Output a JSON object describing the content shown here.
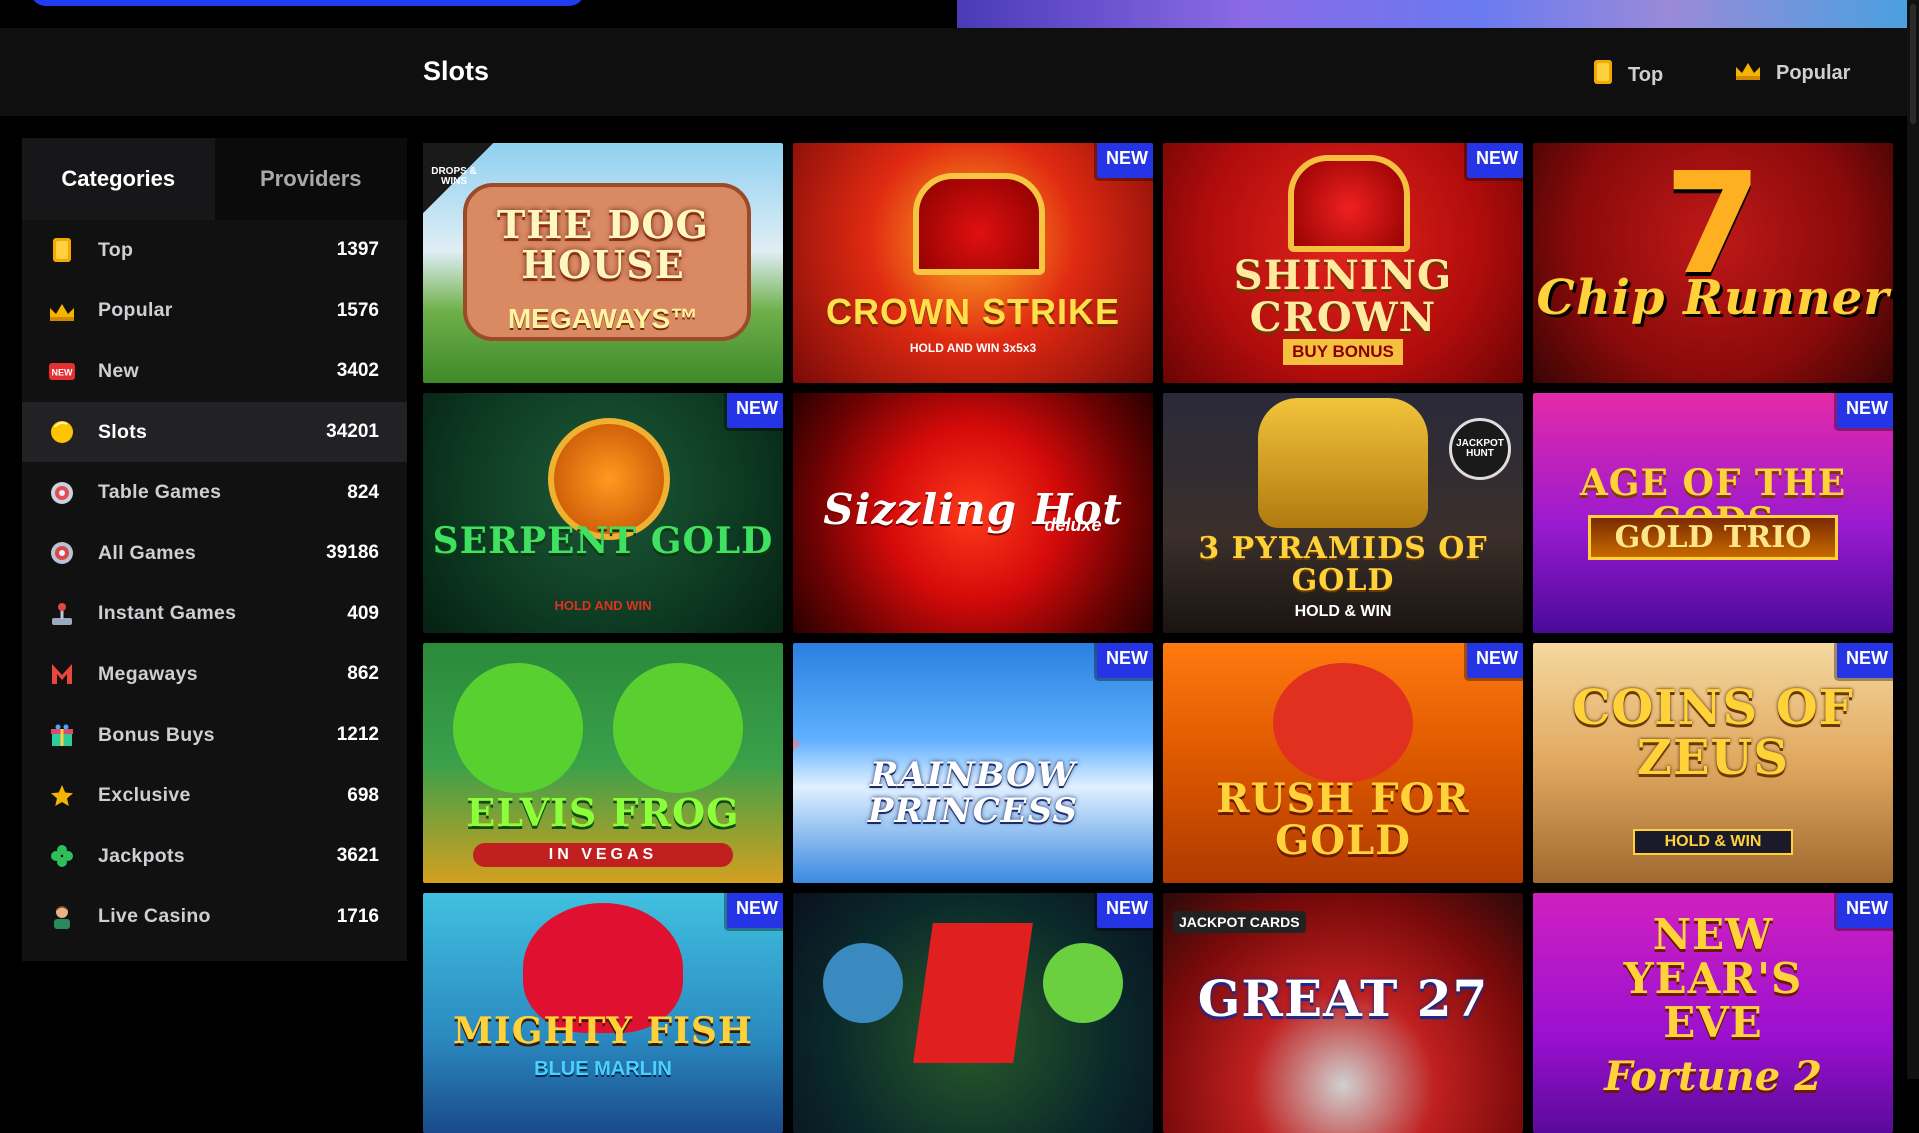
{
  "header": {
    "title": "Slots",
    "links": [
      {
        "label": "Top",
        "icon": "top-icon"
      },
      {
        "label": "Popular",
        "icon": "crown-icon"
      }
    ]
  },
  "sidebar": {
    "tabs": [
      "Categories",
      "Providers"
    ],
    "items": [
      {
        "label": "Top",
        "count": "1397",
        "icon": "top-icon"
      },
      {
        "label": "Popular",
        "count": "1576",
        "icon": "crown-icon"
      },
      {
        "label": "New",
        "count": "3402",
        "icon": "new-icon"
      },
      {
        "label": "Slots",
        "count": "34201",
        "icon": "slots-icon",
        "active": true
      },
      {
        "label": "Table Games",
        "count": "824",
        "icon": "roulette-icon"
      },
      {
        "label": "All Games",
        "count": "39186",
        "icon": "chip-icon"
      },
      {
        "label": "Instant Games",
        "count": "409",
        "icon": "joystick-icon"
      },
      {
        "label": "Megaways",
        "count": "862",
        "icon": "megaways-icon"
      },
      {
        "label": "Bonus Buys",
        "count": "1212",
        "icon": "gift-icon"
      },
      {
        "label": "Exclusive",
        "count": "698",
        "icon": "star-icon"
      },
      {
        "label": "Jackpots",
        "count": "3621",
        "icon": "clover-icon"
      },
      {
        "label": "Live Casino",
        "count": "1716",
        "icon": "dealer-icon"
      }
    ]
  },
  "badge_label": "NEW",
  "games": [
    {
      "title": "THE DOG HOUSE",
      "sub": "MEGAWAYS™",
      "corner": "DROPS & WINS",
      "new": false
    },
    {
      "title": "CROWN STRIKE",
      "sub": "HOLD AND WIN 3x5x3",
      "new": true
    },
    {
      "title": "SHINING CROWN",
      "sub": "BUY BONUS",
      "new": true
    },
    {
      "title": "Chip Runner",
      "sub": "7",
      "new": false
    },
    {
      "title": "SERPENT GOLD",
      "sub": "HOLD AND WIN",
      "new": true
    },
    {
      "title": "Sizzling Hot",
      "sub": "deluxe",
      "new": false
    },
    {
      "title": "3 PYRAMIDS OF GOLD",
      "sub": "HOLD & WIN",
      "corner": "JACKPOT HUNT",
      "new": false
    },
    {
      "title": "AGE OF THE GODS",
      "sub": "GOLD TRIO",
      "new": true
    },
    {
      "title": "ELVIS FROG",
      "sub": "IN VEGAS",
      "new": false
    },
    {
      "title": "RAINBOW PRINCESS",
      "sub": "",
      "new": true
    },
    {
      "title": "RUSH FOR GOLD",
      "sub": "",
      "new": true
    },
    {
      "title": "COINS OF ZEUS",
      "sub": "HOLD & WIN",
      "new": true
    },
    {
      "title": "MIGHTY FISH",
      "sub": "BLUE MARLIN",
      "new": true
    },
    {
      "title": "",
      "sub": "",
      "new": true
    },
    {
      "title": "GREAT 27",
      "sub": "",
      "corner": "JACKPOT CARDS",
      "new": false
    },
    {
      "title": "NEW YEAR'S EVE",
      "sub": "Fortune 2",
      "new": true
    }
  ]
}
